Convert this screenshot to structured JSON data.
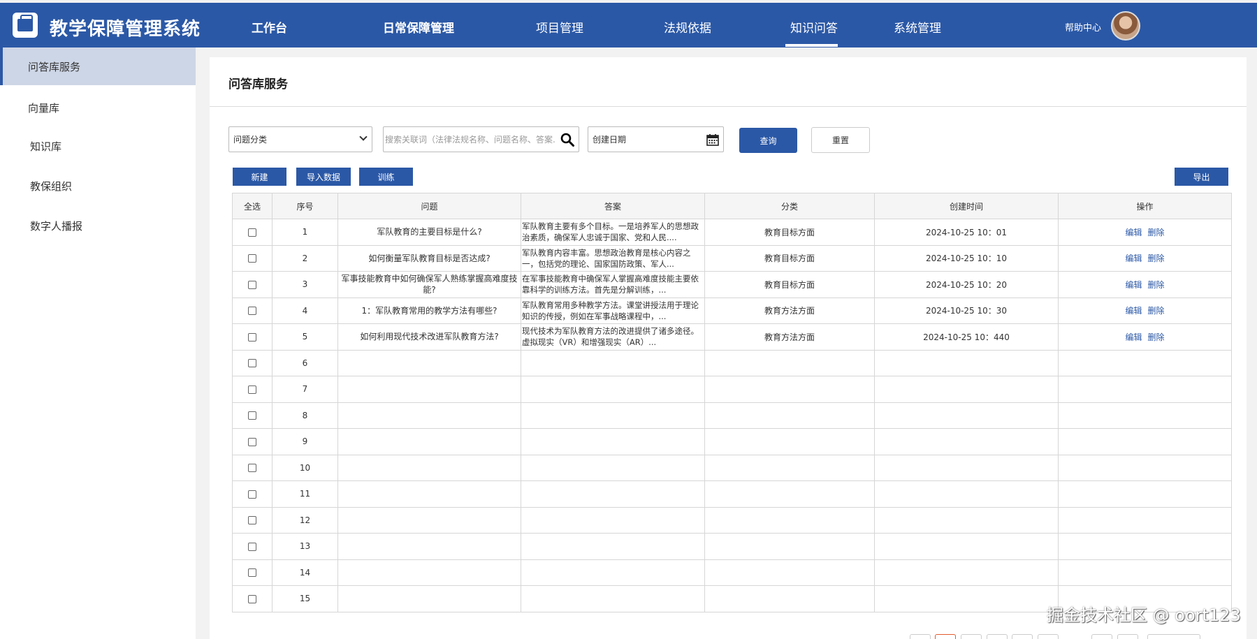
{
  "app": {
    "title": "教学保障管理系统"
  },
  "nav": {
    "items": [
      {
        "label": "工作台"
      },
      {
        "label": "日常保障管理"
      },
      {
        "label": "项目管理"
      },
      {
        "label": "法规依据"
      },
      {
        "label": "知识问答"
      },
      {
        "label": "系统管理"
      }
    ],
    "active": "知识问答",
    "help": "帮助中心"
  },
  "sidebar": {
    "items": [
      {
        "label": "问答库服务"
      },
      {
        "label": "向量库"
      },
      {
        "label": "知识库"
      },
      {
        "label": "教保组织"
      },
      {
        "label": "数字人播报"
      }
    ],
    "active": "问答库服务"
  },
  "page": {
    "title": "问答库服务"
  },
  "filters": {
    "category": "问题分类",
    "search_placeholder": "搜索关联词（法律法规名称、问题名称、答案...",
    "date": "创建日期",
    "query_label": "查询",
    "reset_label": "重置"
  },
  "toolbar": {
    "new_label": "新建",
    "import_label": "导入数据",
    "train_label": "训练",
    "export_label": "导出"
  },
  "table": {
    "headers": [
      "全选",
      "序号",
      "问题",
      "答案",
      "分类",
      "创建时间",
      "操作"
    ],
    "edit_label": "编辑",
    "delete_label": "删除",
    "rows": [
      {
        "no": "1",
        "question": "军队教育的主要目标是什么?",
        "answer": "军队教育主要有多个目标。一是培养军人的思想政治素质，确保军人忠诚于国家、党和人民....",
        "category": "教育目标方面",
        "time": "2024-10-25 10：01"
      },
      {
        "no": "2",
        "question": "如何衡量军队教育目标是否达成?",
        "answer": "军队教育内容丰富。思想政治教育是核心内容之一，包括党的理论、国家国防政策、军人...",
        "category": "教育目标方面",
        "time": "2024-10-25 10：10"
      },
      {
        "no": "3",
        "question": "军事技能教育中如何确保军人熟练掌握高难度技能?",
        "answer": "在军事技能教育中确保军人掌握高难度技能主要依靠科学的训练方法。首先是分解训练，...",
        "category": "教育目标方面",
        "time": "2024-10-25 10：20"
      },
      {
        "no": "4",
        "question": "1：军队教育常用的教学方法有哪些?",
        "answer": "军队教育常用多种教学方法。课堂讲授法用于理论知识的传授，例如在军事战略课程中，...",
        "category": "教育方法方面",
        "time": "2024-10-25 10：30"
      },
      {
        "no": "5",
        "question": "如何利用现代技术改进军队教育方法?",
        "answer": "现代技术为军队教育方法的改进提供了诸多途径。虚拟现实（VR）和增强现实（AR）...",
        "category": "教育方法方面",
        "time": "2024-10-25 10：440"
      },
      {
        "no": "6"
      },
      {
        "no": "7"
      },
      {
        "no": "8"
      },
      {
        "no": "9"
      },
      {
        "no": "10"
      },
      {
        "no": "11"
      },
      {
        "no": "12"
      },
      {
        "no": "13"
      },
      {
        "no": "14"
      },
      {
        "no": "15"
      }
    ]
  },
  "watermark": "掘金技术社区 @ oort123",
  "colors": {
    "primary": "#2b58a6",
    "accent": "#e25b2e"
  }
}
